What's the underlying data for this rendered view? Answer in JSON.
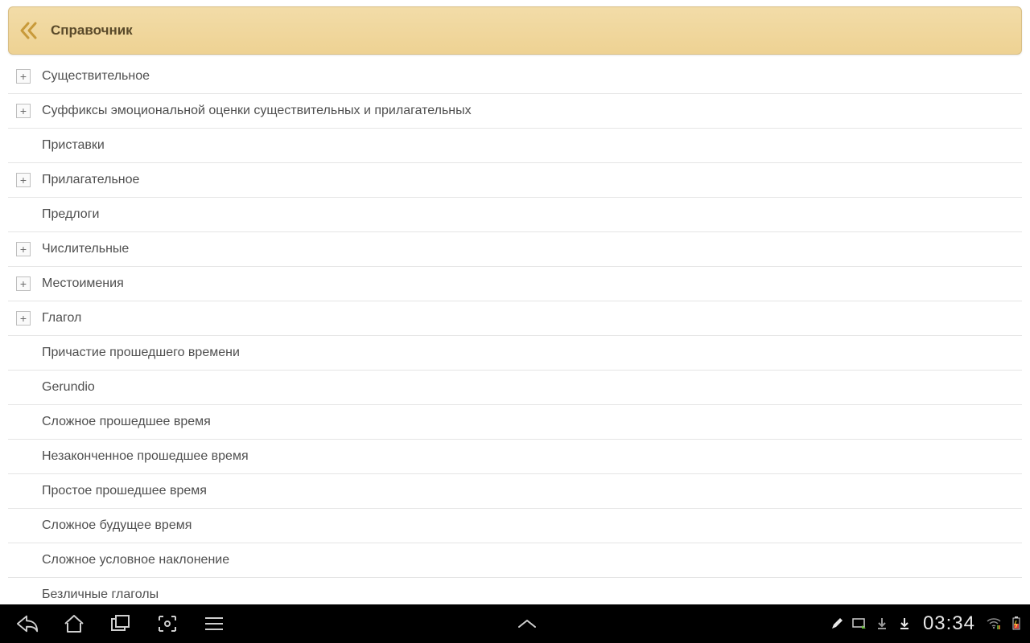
{
  "header": {
    "title": "Справочник"
  },
  "list": {
    "items": [
      {
        "label": "Существительное",
        "expandable": true
      },
      {
        "label": "Суффиксы эмоциональной оценки существительных и прилагательных",
        "expandable": true
      },
      {
        "label": "Приставки",
        "expandable": false
      },
      {
        "label": "Прилагательное",
        "expandable": true
      },
      {
        "label": "Предлоги",
        "expandable": false
      },
      {
        "label": "Числительные",
        "expandable": true
      },
      {
        "label": "Местоимения",
        "expandable": true
      },
      {
        "label": "Глагол",
        "expandable": true
      },
      {
        "label": "Причастие прошедшего времени",
        "expandable": false
      },
      {
        "label": "Gerundio",
        "expandable": false
      },
      {
        "label": "Сложное прошедшее время",
        "expandable": false
      },
      {
        "label": "Незаконченное прошедшее время",
        "expandable": false
      },
      {
        "label": "Простое прошедшее время",
        "expandable": false
      },
      {
        "label": "Сложное будущее время",
        "expandable": false
      },
      {
        "label": "Сложное условное наклонение",
        "expandable": false
      },
      {
        "label": "Безличные глаголы",
        "expandable": false
      }
    ],
    "expand_glyph": "+"
  },
  "sysbar": {
    "clock": "03:34"
  }
}
